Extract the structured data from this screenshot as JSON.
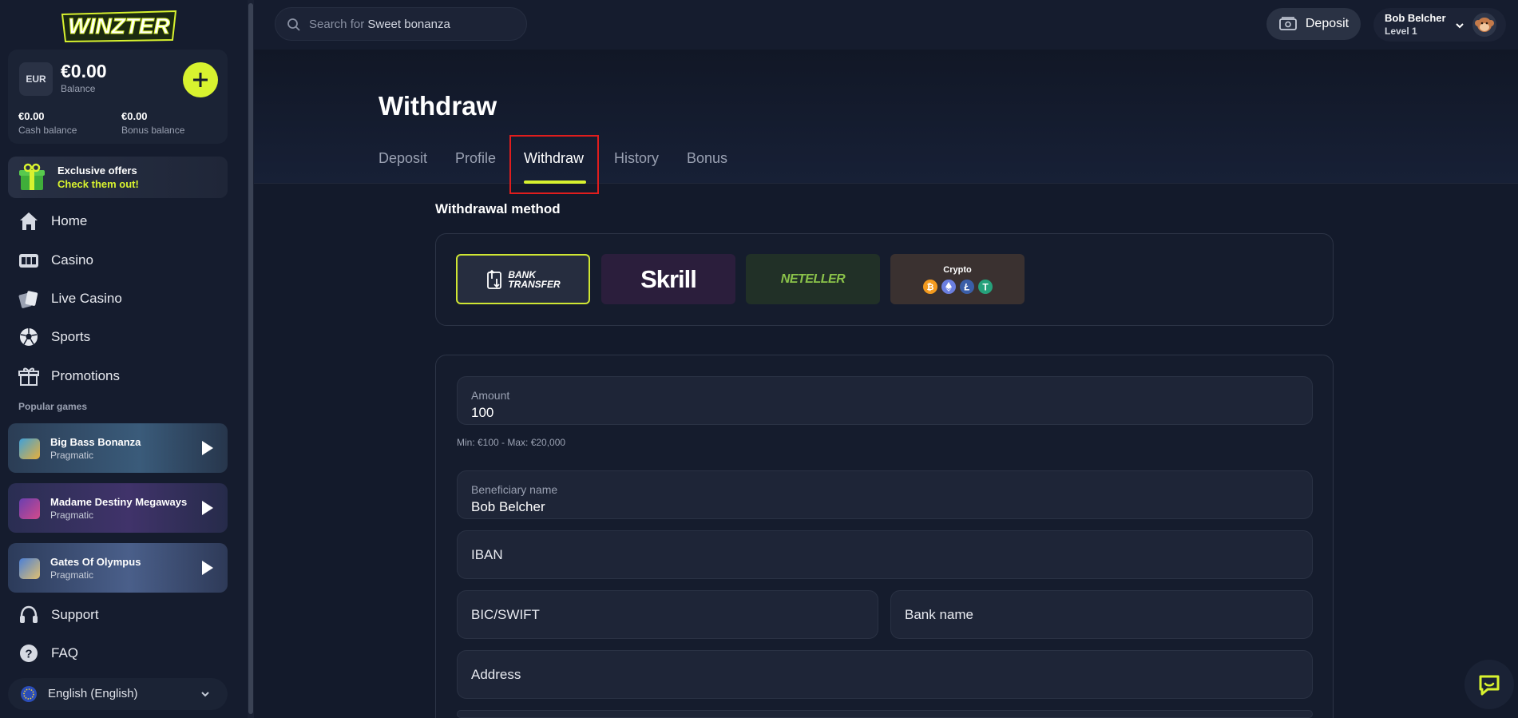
{
  "brand": {
    "logo_text": "WINZTER",
    "accent": "#d8f22f"
  },
  "wallet": {
    "currency": "EUR",
    "balance": "€0.00",
    "balance_label": "Balance",
    "cash_value": "€0.00",
    "cash_label": "Cash balance",
    "bonus_value": "€0.00",
    "bonus_label": "Bonus balance"
  },
  "offers": {
    "line1": "Exclusive offers",
    "line2": "Check them out!"
  },
  "nav": {
    "home": "Home",
    "casino": "Casino",
    "live_casino": "Live Casino",
    "sports": "Sports",
    "promotions": "Promotions",
    "support": "Support",
    "faq": "FAQ"
  },
  "popular": {
    "title": "Popular games",
    "games": [
      {
        "name": "Big Bass Bonanza",
        "provider": "Pragmatic"
      },
      {
        "name": "Madame Destiny Megaways",
        "provider": "Pragmatic"
      },
      {
        "name": "Gates Of Olympus",
        "provider": "Pragmatic"
      }
    ]
  },
  "language": {
    "selected": "English (English)"
  },
  "search": {
    "prefix": "Search for",
    "suggestion": "Sweet bonanza"
  },
  "header": {
    "deposit_label": "Deposit",
    "user_name": "Bob Belcher",
    "user_level": "Level 1"
  },
  "page": {
    "title": "Withdraw",
    "tabs": [
      "Deposit",
      "Profile",
      "Withdraw",
      "History",
      "Bonus"
    ],
    "active_tab": "Withdraw"
  },
  "methods": {
    "title": "Withdrawal method",
    "bank_line1": "BANK",
    "bank_line2": "TRANSFER",
    "skrill": "Skrill",
    "neteller": "NETELLER",
    "crypto": "Crypto",
    "selected": "Bank Transfer"
  },
  "form": {
    "amount_label": "Amount",
    "amount_value": "100",
    "amount_hint": "Min: €100 - Max: €20,000",
    "beneficiary_label": "Beneficiary name",
    "beneficiary_value": "Bob Belcher",
    "iban": "IBAN",
    "bic": "BIC/SWIFT",
    "bank_name": "Bank name",
    "address": "Address"
  }
}
